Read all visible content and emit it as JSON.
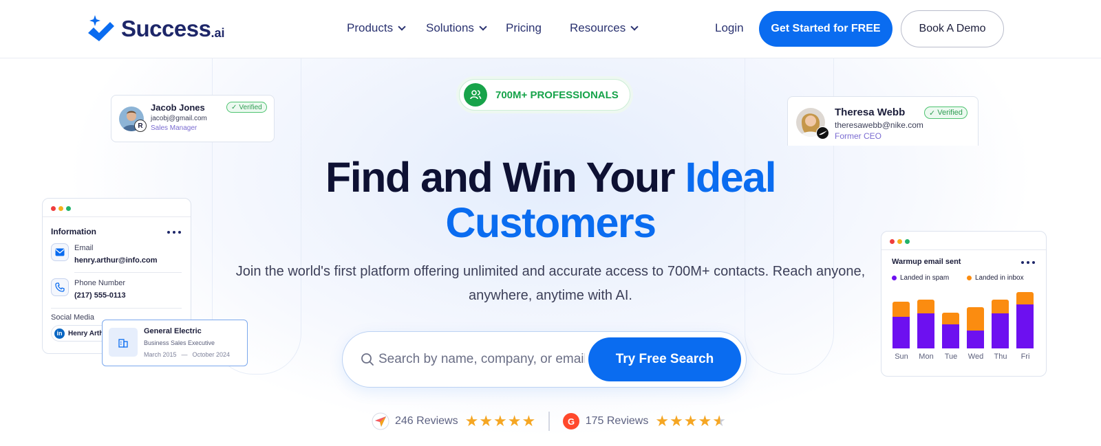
{
  "brand": {
    "name": "Success",
    "suffix": ".ai"
  },
  "nav": {
    "items": [
      {
        "label": "Products",
        "dropdown": true
      },
      {
        "label": "Solutions",
        "dropdown": true
      },
      {
        "label": "Pricing",
        "dropdown": false
      },
      {
        "label": "Resources",
        "dropdown": true
      }
    ],
    "login": "Login",
    "cta_primary": "Get Started for FREE",
    "cta_secondary": "Book A Demo"
  },
  "hero": {
    "pill": "700M+ PROFESSIONALS",
    "headline_dark": "Find and Win Your",
    "headline_accent_1": "Ideal",
    "headline_accent_2": "Customers",
    "subheadline": "Join the world's first platform offering unlimited and accurate access to 700M+ contacts. Reach anyone, anywhere, anytime with AI.",
    "search": {
      "placeholder": "Search by name, company, or email",
      "button": "Try Free Search"
    },
    "reviews": [
      {
        "count": "246 Reviews",
        "rating": 5,
        "icon": "capterra-icon"
      },
      {
        "count": "175 Reviews",
        "rating": 4.5,
        "icon": "g2-icon"
      }
    ]
  },
  "cards": {
    "jacob": {
      "name": "Jacob Jones",
      "email": "jacobj@gmail.com",
      "role": "Sales Manager",
      "badge": "Verified"
    },
    "theresa": {
      "name": "Theresa Webb",
      "email": "theresawebb@nike.com",
      "role": "Former CEO",
      "badge": "Verified"
    },
    "information": {
      "title": "Information",
      "email_label": "Email",
      "email_value": "henry.arthur@info.com",
      "phone_label": "Phone Number",
      "phone_value": "(217) 555-0113",
      "social_label": "Social Media",
      "social_value": "Henry Arthur"
    },
    "company": {
      "name": "General Electric",
      "role": "Business Sales Executive",
      "start": "March 2015",
      "dash": "—",
      "end": "October 2024"
    },
    "warmup": {
      "title": "Warmup email sent",
      "legend_spam": "Landed in spam",
      "legend_inbox": "Landed in inbox"
    }
  },
  "colors": {
    "accent": "#0a6cf0",
    "navy": "#1e2769",
    "green": "#16a34a",
    "spam": "#6d10f0",
    "inbox": "#fb8c10",
    "star": "#f5a623"
  },
  "chart_data": {
    "type": "bar",
    "stacked": true,
    "categories": [
      "Sun",
      "Mon",
      "Tue",
      "Wed",
      "Thu",
      "Fri"
    ],
    "series": [
      {
        "name": "Landed in spam",
        "values": [
          46,
          51,
          35,
          26,
          51,
          64
        ]
      },
      {
        "name": "Landed in inbox",
        "values": [
          22,
          20,
          17,
          34,
          20,
          18
        ]
      }
    ],
    "title": "Warmup email sent",
    "legend_position": "top-left",
    "ylim": [
      0,
      85
    ],
    "grid": false
  }
}
